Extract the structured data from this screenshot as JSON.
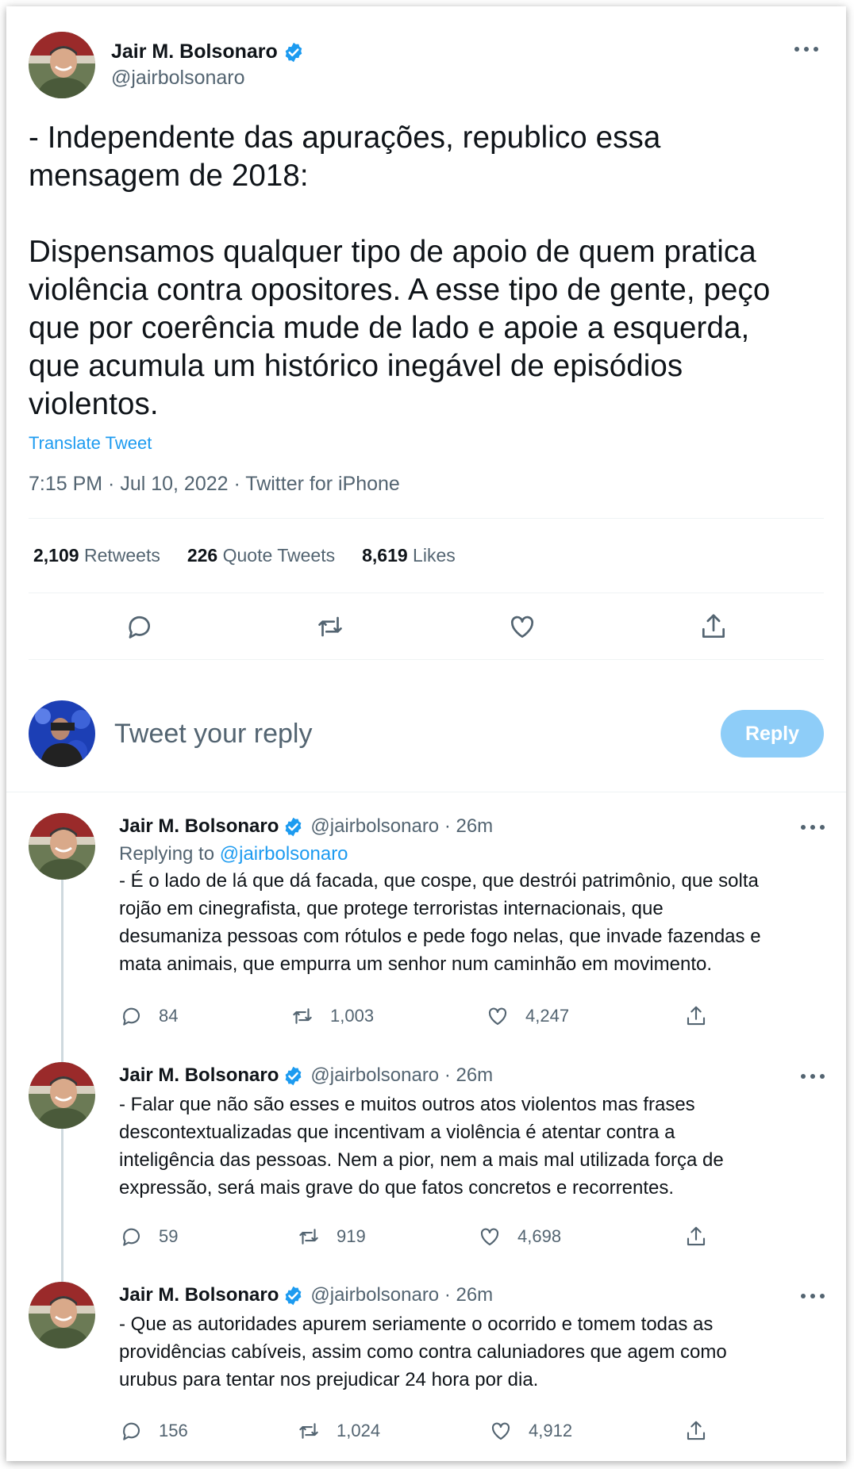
{
  "main_tweet": {
    "author_name": "Jair M. Bolsonaro",
    "author_handle": "@jairbolsonaro",
    "text": "- Independente das apurações, republico essa\nmensagem de 2018:\n\nDispensamos qualquer tipo de apoio de quem pratica\nviolência contra opositores. A esse tipo de gente, peço\nque por coerência mude de lado e apoie a esquerda,\nque acumula um histórico inegável de episódios\nviolentos.",
    "translate_label": "Translate Tweet",
    "meta": "7:15 PM · Jul 10, 2022 · Twitter for iPhone",
    "stats": {
      "retweets_count": "2,109",
      "retweets_label": "Retweets",
      "quotes_count": "226",
      "quotes_label": "Quote Tweets",
      "likes_count": "8,619",
      "likes_label": "Likes"
    }
  },
  "compose": {
    "placeholder": "Tweet your reply",
    "reply_button": "Reply"
  },
  "replies": [
    {
      "author_name": "Jair M. Bolsonaro",
      "author_handle": "@jairbolsonaro · 26m",
      "replying_prefix": "Replying to",
      "replying_handle": "@jairbolsonaro",
      "text": "- É o lado de lá que dá facada, que cospe, que destrói patrimônio, que solta\nrojão em cinegrafista, que protege terroristas internacionais, que\ndesumaniza pessoas com rótulos e pede fogo nelas, que invade fazendas e\nmata animais, que empurra um senhor num caminhão em movimento.",
      "replies": "84",
      "retweets": "1,003",
      "likes": "4,247"
    },
    {
      "author_name": "Jair M. Bolsonaro",
      "author_handle": "@jairbolsonaro · 26m",
      "text": "- Falar que não são esses e muitos outros atos violentos mas frases\ndescontextualizadas que incentivam a violência é atentar contra a\ninteligência das pessoas. Nem a pior, nem a mais mal utilizada força de\nexpressão, será mais grave do que fatos concretos e recorrentes.",
      "replies": "59",
      "retweets": "919",
      "likes": "4,698"
    },
    {
      "author_name": "Jair M. Bolsonaro",
      "author_handle": "@jairbolsonaro · 26m",
      "text": "- Que as autoridades apurem seriamente o ocorrido e tomem todas as\nprovidências cabíveis, assim como contra caluniadores que agem como\nurubus para tentar nos prejudicar 24 hora por dia.",
      "replies": "156",
      "retweets": "1,024",
      "likes": "4,912"
    }
  ],
  "icons": {
    "verified": "verified-badge-icon",
    "more": "more-horizontal-icon",
    "reply": "reply-bubble-icon",
    "retweet": "retweet-icon",
    "like": "heart-icon",
    "share": "share-icon"
  },
  "colors": {
    "accent": "#1d9bf0",
    "reply_button_disabled": "#8ecdf8",
    "secondary_text": "#536471",
    "primary_text": "#0f1419",
    "border": "#eff3f4"
  }
}
